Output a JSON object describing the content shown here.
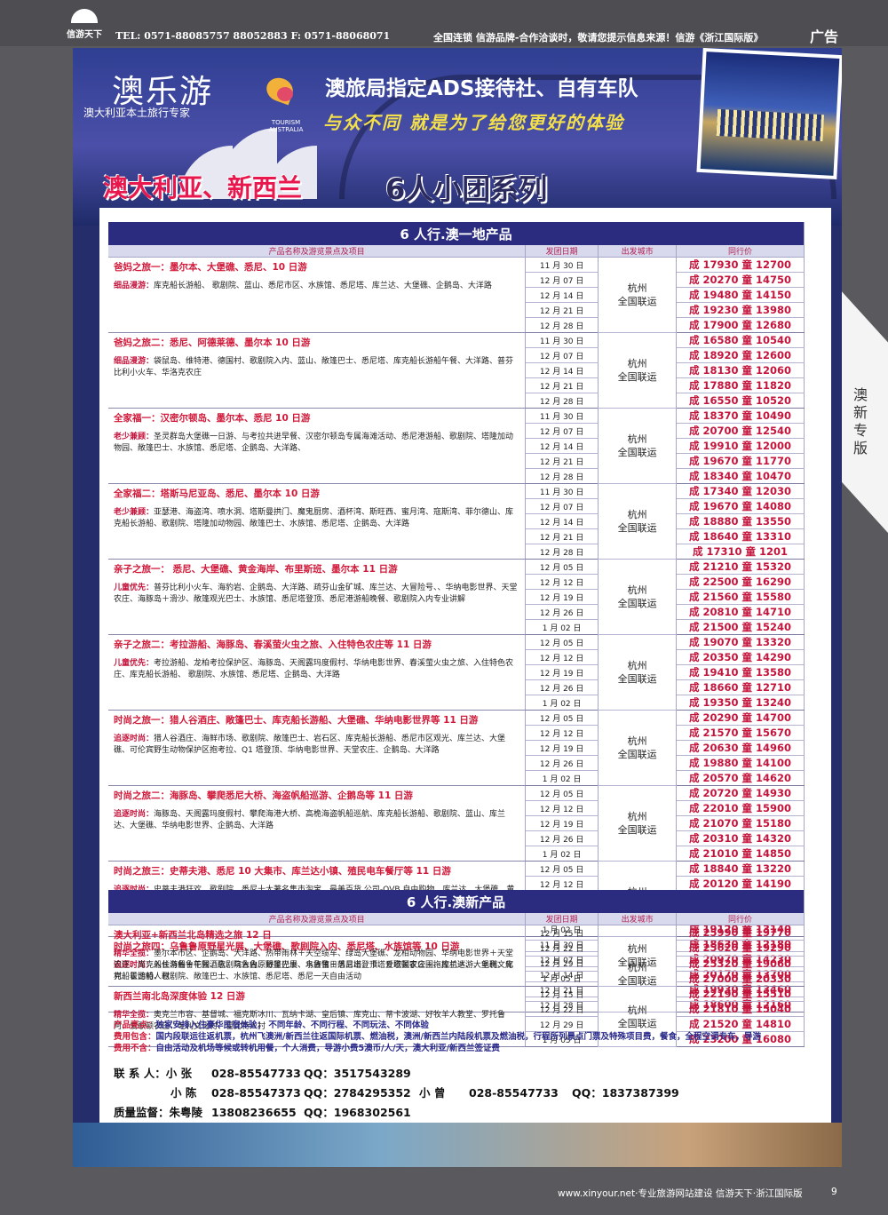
{
  "header": {
    "logo_text": "信游天下",
    "tel": "TEL: 0571-88085757 88052883   F: 0571-88068071",
    "slogan": "全国连锁 信游品牌-合作洽谈时，敬请您提示信息来源！信游《浙江国际版》",
    "ad_label": "广告"
  },
  "side_tab": "澳新专版",
  "banner": {
    "brand": "澳乐游",
    "brand_sub": "澳大利亚本土旅行专家",
    "tourism_logo": "TOURISM AUSTRALIA",
    "ads_line": "澳旅局指定ADS接待社、自有车队",
    "diff_line": "与众不同  就是为了给您更好的体验",
    "title_left": "澳大利亚、新西兰",
    "title_right": "6人小团系列"
  },
  "section1": {
    "title": "6 人行.澳一地产品",
    "col_product": "产品名称及游览景点及项目",
    "col_date": "发团日期",
    "col_city": "出发城市",
    "col_price": "同行价",
    "products": [
      {
        "title": "爸妈之旅一：墨尔本、大堡礁、悉尼、10 日游",
        "desc_label": "细品漫游：",
        "desc": "库克船长游船、 歌剧院、蓝山、悉尼市区、水族馆、悉尼塔、库兰达、大堡礁、企鹅岛、大洋路",
        "city": "杭州\n全国联运",
        "dates": [
          "11 月 30 日",
          "12 月 07 日",
          "12 月 14 日",
          "12 月 21 日",
          "12 月 28 日"
        ],
        "prices": [
          "成 17930   童 12700",
          "成 20270   童 14750",
          "成 19480   童 14150",
          "成 19230   童 13980",
          "成 17900   童 12680"
        ]
      },
      {
        "title": "爸妈之旅二：悉尼、阿德莱德、墨尔本  10 日游",
        "desc_label": "细品漫游：",
        "desc": "袋鼠岛、维特港、德国村、歌剧院入内、蓝山、敞篷巴士、悉尼塔、库克船长游船午餐、大洋路、普芬比利小火车、华洛克农庄",
        "city": "杭州\n全国联运",
        "dates": [
          "11 月 30 日",
          "12 月 07 日",
          "12 月 14 日",
          "12 月 21 日",
          "12 月 28 日"
        ],
        "prices": [
          "成 16580   童 10540",
          "成 18920   童 12600",
          "成 18130   童 12060",
          "成 17880   童 11820",
          "成 16550   童 10520"
        ]
      },
      {
        "title": "全家福一：汉密尔顿岛、墨尔本、悉尼 10 日游",
        "desc_label": "老少兼顾：",
        "desc": "圣灵群岛大堡礁一日游、与考拉共进早餐、汉密尔顿岛专属海滩活动、悉尼港游船、歌剧院、塔隆加动物园、敞篷巴士、水族馆、悉尼塔、企鹅岛、大洋路、",
        "city": "杭州\n全国联运",
        "dates": [
          "11 月 30 日",
          "12 月 07 日",
          "12 月 14 日",
          "12 月 21 日",
          "12 月 28 日"
        ],
        "prices": [
          "成 18370   童 10490",
          "成 20700   童 12540",
          "成 19910   童 12000",
          "成 19670   童 11770",
          "成 18340   童 10470"
        ]
      },
      {
        "title": "全家福二：塔斯马尼亚岛、悉尼、墨尔本 10 日游",
        "desc_label": "老少兼顾：",
        "desc": "亚瑟港、海盗湾、喷水洞、塔斯曼拱门、魔鬼厨房、酒杯湾、斯旺西、蜜月湾、寇斯湾、菲尔德山、库克船长游船、歌剧院、塔隆加动物园、敞篷巴士、水族馆、悉尼塔、企鹅岛、大洋路",
        "city": "杭州\n全国联运",
        "dates": [
          "11 月 30 日",
          "12 月 07 日",
          "12 月 14 日",
          "12 月 21 日",
          "12 月 28 日"
        ],
        "prices": [
          "成 17340   童 12030",
          "成 19670   童 14080",
          "成 18880   童 13550",
          "成 18640   童 13310",
          "成 17310   童 1201"
        ]
      },
      {
        "title": "亲子之旅一： 悉尼、大堡礁、黄金海岸、布里斯班、墨尔本 11 日游",
        "desc_label": "儿童优先：",
        "desc": "普芬比利小火车、海豹岩、企鹅岛、大洋路、疏芬山金矿城、库兰达、大冒险号、、华纳电影世界、天堂农庄、海豚岛＋滑沙、敞篷观光巴士、水族馆、悉尼塔登顶、悉尼港游船晚餐、歌剧院入内专业讲解",
        "city": "杭州\n全国联运",
        "dates": [
          "12 月 05 日",
          "12 月 12 日",
          "12 月 19 日",
          "12 月 26 日",
          "1 月 02 日"
        ],
        "prices": [
          "成 21210   童 15320",
          "成 22500   童 16290",
          "成 21560   童 15580",
          "成 20810   童 14710",
          "成 21500   童 15240"
        ]
      },
      {
        "title": "亲子之旅二：考拉游船、海豚岛、春溪萤火虫之旅、入住特色农庄等 11 日游",
        "desc_label": "儿童优先：",
        "desc": "考拉游船、龙柏考拉保护区、海豚岛、天阁露玛度假村、华纳电影世界、春溪萤火虫之旅、入住特色农庄、库克船长游船、 歌剧院、水族馆、悉尼塔、企鹅岛、大洋路",
        "city": "杭州\n全国联运",
        "dates": [
          "12 月 05 日",
          "12 月 12 日",
          "12 月 19 日",
          "12 月 26 日",
          "1 月 02 日"
        ],
        "prices": [
          "成 19070   童 13320",
          "成 20350   童 14290",
          "成 19410   童 13580",
          "成 18660   童 12710",
          "成 19350   童 13240"
        ]
      },
      {
        "title": "时尚之旅一：猎人谷酒庄、敞篷巴士、库克船长游船、大堡礁、华纳电影世界等 11 日游",
        "desc_label": "追逐时尚：",
        "desc": "猎人谷酒庄、海鲜市场、歌剧院、敞篷巴士、岩石区、库克船长游船、悉尼市区观光、库兰达、大堡礁、可伦宾野生动物保护区抱考拉、Q1 塔登顶、华纳电影世界、天堂农庄、企鹅岛、大洋路",
        "city": "杭州\n全国联运",
        "dates": [
          "12 月 05 日",
          "12 月 12 日",
          "12 月 19 日",
          "12 月 26 日",
          "1 月 02 日"
        ],
        "prices": [
          "成 20290   童 14700",
          "成 21570   童 15670",
          "成 20630   童 14960",
          "成 19880   童 14100",
          "成 20570   童 14620"
        ]
      },
      {
        "title": "时尚之旅二：海豚岛、攀爬悉尼大桥、海盗帆船巡游、企鹅岛等 11 日游",
        "desc_label": "追逐时尚：",
        "desc": "海豚岛、天阁露玛度假村、攀爬海港大桥、高桅海盗帆船巡航、库克船长游船、歌剧院、蓝山、库兰达、大堡礁、华纳电影世界、企鹅岛、大洋路",
        "city": "杭州\n全国联运",
        "dates": [
          "12 月 05 日",
          "12 月 12 日",
          "12 月 19 日",
          "12 月 26 日",
          "1 月 02 日"
        ],
        "prices": [
          "成 20720   童 14930",
          "成 22010   童 15900",
          "成 21070   童 15180",
          "成 20310   童 14320",
          "成 21010   童 14850"
        ]
      },
      {
        "title": "时尚之旅三：史蒂夫港、悉尼 10 大集市、库兰达小镇、殖民电车餐厅等 11 日游",
        "desc_label": "追逐时尚：",
        "desc": "史蒂夫港狂欢、歌剧院、悉尼十大著名集市淘宝、最美百货 公司-QVB 自由购物、库兰达、大堡礁、黄金海岸自由活动、龙柏考拉保护区、墨尔本殖民电车餐厅、复古电车、摩天轮飞车体验",
        "city": "杭州\n全国联运",
        "dates": [
          "12 月 05 日",
          "12 月 12 日",
          "12 月 19 日",
          "12 月 26 日",
          "1 月 02 日"
        ],
        "prices": [
          "成 18840   童 13220",
          "成 20120   童 14190",
          "成 19180   童 13480",
          "成 18430   童 12620",
          "成 19120   童 13140"
        ]
      },
      {
        "title": "时尚之旅四：乌鲁鲁原野星光展、大堡礁、歌剧院入内、悉尼塔、水族馆等 10 日游",
        "desc_label": "追逐时尚：",
        "desc": "入住乌鲁鲁花园酒店、乌鲁鲁原野星光展、乌鲁鲁日落日出、卡塔丘塔国家公园、库兰达、大堡礁、库克船长游船、歌剧院、敞篷巴士、水族馆、悉尼塔、悉尼一天自由活动",
        "city": "杭州\n全国联运",
        "dates": [
          "11 月 30 日",
          "12 月 07 日",
          "12 月 14 日",
          "12 月 21 日",
          "12 月 28 日"
        ],
        "prices": [
          "成 18630   童 12180",
          "成 20970   童 14230",
          "成 20170   童 13700",
          "成 19930   童 13460",
          "成 18600   童 12160"
        ]
      }
    ]
  },
  "section2": {
    "title": "6 人行.澳新产品",
    "col_product": "产品名称及游览景点及项目",
    "col_date": "发团日期",
    "col_city": "出发城市",
    "col_price": "同行价",
    "products": [
      {
        "title": "澳大利亚+新西兰北岛精选之旅 12 日",
        "desc_label": "精华全揽：",
        "desc": "墨尔本市区、企鹅岛、大洋路、热带雨林＋天空缆车、绿岛大堡礁、龙柏动物园、华纳电影世界＋天堂农庄、库克船长游船＋午餐、歌剧院入内、敞篷巴士、水族馆＋悉尼塔登顶、爱歌顿农庄＋拖拉机巡游、毛利文化村、霍比特人村",
        "city": "杭州\n全国联运",
        "dates": [
          "12 月 15 日",
          "12 月 22 日",
          "12 月 29 日",
          "1 月 05 日"
        ],
        "prices": [
          "成 25990   童 19770",
          "成 25620   童 19290",
          "成 25320   童 19060",
          "成 27000   童 20330"
        ]
      },
      {
        "title": "新西兰南北岛深度体验 12 日游",
        "desc_label": "精华全揽：",
        "desc": "奥克兰市容、基督城、福克斯冰川、瓦纳卡湖、皇后镇、库克山、蒂卡波湖、好牧羊人教堂、罗托鲁阿、爱歌顿农庄、毛利文化村、霍比特人村",
        "city": "杭州\n全国联运",
        "dates": [
          "12 月 15 日",
          "12 月 22 日",
          "12 月 29 日",
          "1 月 05 日"
        ],
        "prices": [
          "成 22190   童 15510",
          "成 21810   童 15040",
          "成 21520   童 14810",
          "成 23200   童 16080"
        ]
      }
    ]
  },
  "notes": {
    "l1_label": "产品亮点：",
    "l1": "独家安排入住豪华民宿体验；    不同年龄、不同行程、不同玩法、不同体验",
    "l2_label": "费用包含：",
    "l2": "国内段联运往返机票，杭州飞澳洲/新西兰往返国际机票、燃油税，澳洲/新西兰内陆段机票及燃油税，行程所列景点门票及特殊项目费，餐食，全程空调专车，导游",
    "l3_label": "费用不含：",
    "l3": "自由活动及机场等候或转机用餐，个人消费，导游小费5澳币/人/天，澳大利亚/新西兰签证费"
  },
  "contacts": {
    "label1": "联 系 人：小  张",
    "tel1": "028-85547733",
    "qq1": "QQ：3517543289",
    "label2": "小  陈",
    "tel2": "028-85547373",
    "qq2": "QQ：2784295352",
    "label3": "小  曾",
    "tel3": "028-85547733",
    "qq3": "QQ：1837387399",
    "label4": "质量监督：朱粤陵",
    "tel4": "13808236655",
    "qq4": "QQ：1968302561"
  },
  "footer": {
    "text": "www.xinyour.net·专业旅游网站建设  信游天下·浙江国际版",
    "page": "9"
  }
}
